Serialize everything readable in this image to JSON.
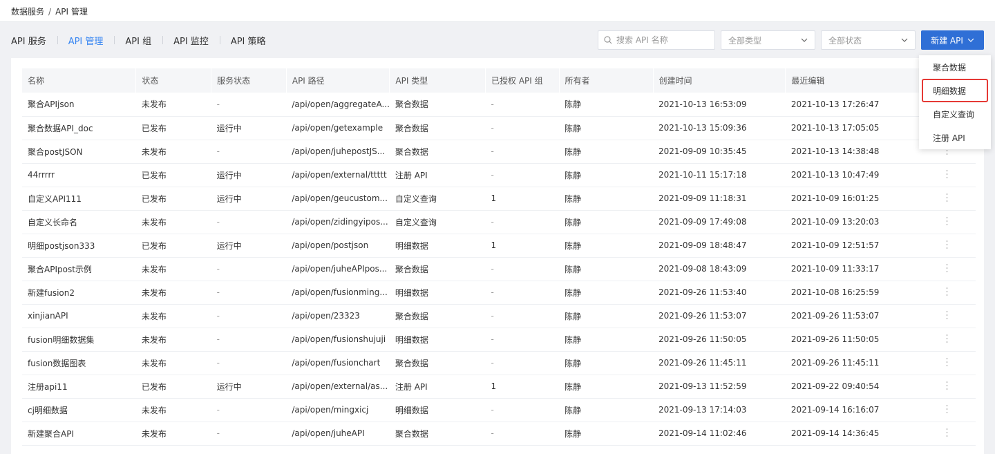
{
  "breadcrumb": {
    "parent": "数据服务",
    "sep": "/",
    "current": "API 管理"
  },
  "tabs": [
    {
      "label": "API 服务"
    },
    {
      "label": "API 管理"
    },
    {
      "label": "API 组"
    },
    {
      "label": "API 监控"
    },
    {
      "label": "API 策略"
    }
  ],
  "active_tab": 1,
  "search": {
    "placeholder": "搜索 API 名称"
  },
  "filters": {
    "type_value": "全部类型",
    "status_value": "全部状态"
  },
  "new_button": {
    "label": "新建 API"
  },
  "accent": "#2f6fd6",
  "table": {
    "columns": [
      "名称",
      "状态",
      "服务状态",
      "API 路径",
      "API 类型",
      "已授权 API 组",
      "所有者",
      "创建时间",
      "最近编辑"
    ],
    "rows": [
      [
        "聚合APIjson",
        "未发布",
        "-",
        "/api/open/aggregateA...",
        "聚合数据",
        "-",
        "陈静",
        "2021-10-13 16:53:09",
        "2021-10-13 17:26:47"
      ],
      [
        "聚合数据API_doc",
        "已发布",
        "运行中",
        "/api/open/getexample",
        "聚合数据",
        "-",
        "陈静",
        "2021-10-13 15:09:36",
        "2021-10-13 17:05:05"
      ],
      [
        "聚合postJSON",
        "未发布",
        "-",
        "/api/open/juhepostJS...",
        "聚合数据",
        "-",
        "陈静",
        "2021-09-09 10:35:45",
        "2021-10-13 14:38:48"
      ],
      [
        "44rrrrr",
        "已发布",
        "运行中",
        "/api/open/external/ttttt",
        "注册 API",
        "-",
        "陈静",
        "2021-10-11 15:17:18",
        "2021-10-13 10:47:49"
      ],
      [
        "自定义API111",
        "已发布",
        "运行中",
        "/api/open/geucustom...",
        "自定义查询",
        "1",
        "陈静",
        "2021-09-09 11:18:31",
        "2021-10-09 16:01:25"
      ],
      [
        "自定义长命名",
        "未发布",
        "-",
        "/api/open/zidingyipos...",
        "自定义查询",
        "-",
        "陈静",
        "2021-09-09 17:49:08",
        "2021-10-09 13:20:03"
      ],
      [
        "明细postjson333",
        "已发布",
        "运行中",
        "/api/open/postjson",
        "明细数据",
        "1",
        "陈静",
        "2021-09-09 18:48:47",
        "2021-10-09 12:51:57"
      ],
      [
        "聚合APIpost示例",
        "未发布",
        "-",
        "/api/open/juheAPIpos...",
        "聚合数据",
        "-",
        "陈静",
        "2021-09-08 18:43:09",
        "2021-10-09 11:33:17"
      ],
      [
        "新建fusion2",
        "未发布",
        "-",
        "/api/open/fusionming...",
        "明细数据",
        "-",
        "陈静",
        "2021-09-26 11:53:40",
        "2021-10-08 16:25:59"
      ],
      [
        "xinjianAPI",
        "未发布",
        "-",
        "/api/open/23323",
        "聚合数据",
        "-",
        "陈静",
        "2021-09-26 11:53:07",
        "2021-09-26 11:53:07"
      ],
      [
        "fusion明细数据集",
        "未发布",
        "-",
        "/api/open/fusionshujuji",
        "明细数据",
        "-",
        "陈静",
        "2021-09-26 11:50:05",
        "2021-09-26 11:50:05"
      ],
      [
        "fusion数据图表",
        "未发布",
        "-",
        "/api/open/fusionchart",
        "聚合数据",
        "-",
        "陈静",
        "2021-09-26 11:45:11",
        "2021-09-26 11:45:11"
      ],
      [
        "注册api11",
        "已发布",
        "运行中",
        "/api/open/external/as...",
        "注册 API",
        "1",
        "陈静",
        "2021-09-13 11:52:59",
        "2021-09-22 09:40:54"
      ],
      [
        "cj明细数据",
        "未发布",
        "-",
        "/api/open/mingxicj",
        "明细数据",
        "-",
        "陈静",
        "2021-09-13 17:14:03",
        "2021-09-14 16:16:07"
      ],
      [
        "新建聚合API",
        "未发布",
        "-",
        "/api/open/juheAPI",
        "聚合数据",
        "-",
        "陈静",
        "2021-09-14 11:02:46",
        "2021-09-14 14:36:45"
      ]
    ]
  },
  "dropdown": {
    "items": [
      {
        "label": "聚合数据"
      },
      {
        "label": "明细数据"
      },
      {
        "label": "自定义查询"
      },
      {
        "label": "注册 API"
      }
    ],
    "highlighted_index": 1
  }
}
